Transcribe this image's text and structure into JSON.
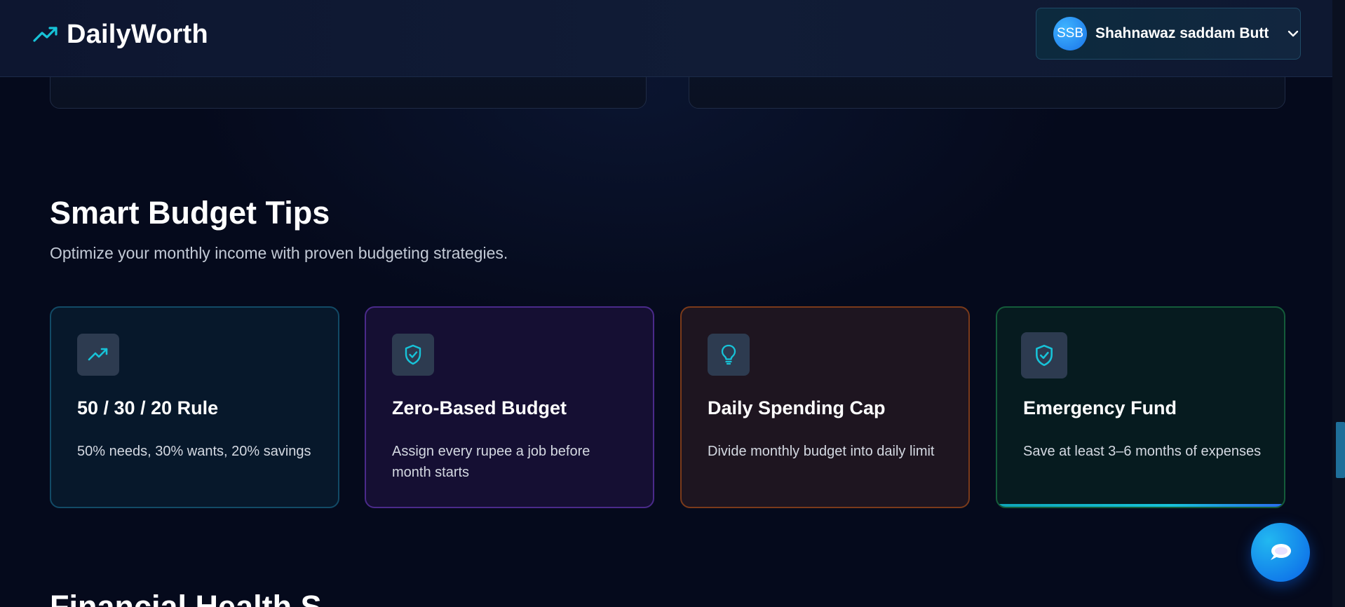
{
  "header": {
    "brand_name": "DailyWorth",
    "user": {
      "initials": "SSB",
      "name": "Shahnawaz saddam Butt"
    }
  },
  "section": {
    "title": "Smart Budget Tips",
    "subtitle": "Optimize your monthly income with proven budgeting strategies."
  },
  "tips": [
    {
      "title": "50 / 30 / 20 Rule",
      "text": "50% needs, 30% wants, 20% savings",
      "icon": "trend-up-icon"
    },
    {
      "title": "Zero-Based Budget",
      "text": "Assign every rupee a job before month starts",
      "icon": "shield-check-icon"
    },
    {
      "title": "Daily Spending Cap",
      "text": "Divide monthly budget into daily limit",
      "icon": "lightbulb-icon"
    },
    {
      "title": "Emergency Fund",
      "text": "Save at least 3–6 months of expenses",
      "icon": "shield-check-icon"
    }
  ],
  "next_section": {
    "title": "Financial Health S"
  },
  "colors": {
    "accent": "#17c3d8",
    "background": "#050a1c",
    "card_borders": [
      "#124a66",
      "#4a2a8a",
      "#7a3a1a",
      "#145c3a"
    ]
  }
}
